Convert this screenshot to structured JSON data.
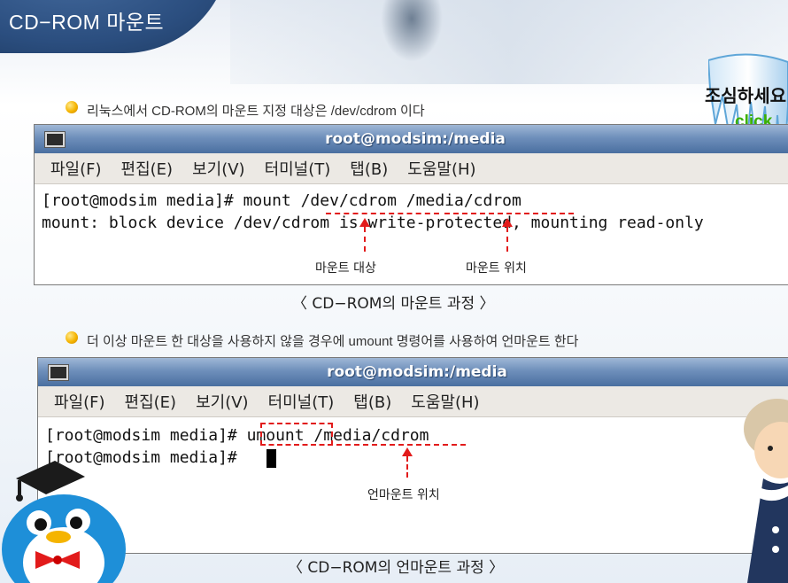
{
  "page": {
    "title": "CD−ROM 마운트"
  },
  "notice": {
    "text": "조심하세요",
    "click": "click"
  },
  "section1": {
    "bullet": "리눅스에서 CD-ROM의 마운트 지정 대상은 /dev/cdrom 이다",
    "window_title": "root@modsim:/media",
    "menu": [
      "파일(F)",
      "편집(E)",
      "보기(V)",
      "터미널(T)",
      "탭(B)",
      "도움말(H)"
    ],
    "lines": [
      "[root@modsim media]# mount /dev/cdrom /media/cdrom",
      "mount: block device /dev/cdrom is write-protected, mounting read-only"
    ],
    "annotation_target": "마운트 대상",
    "annotation_location": "마운트 위치",
    "caption": "〈 CD−ROM의 마운트 과정 〉"
  },
  "section2": {
    "bullet": "더 이상 마운트 한 대상을 사용하지 않을 경우에 umount 명령어를 사용하여 언마운트 한다",
    "window_title": "root@modsim:/media",
    "menu": [
      "파일(F)",
      "편집(E)",
      "보기(V)",
      "터미널(T)",
      "탭(B)",
      "도움말(H)"
    ],
    "lines": [
      "[root@modsim media]# umount /media/cdrom",
      "[root@modsim media]# "
    ],
    "annotation_location": "언마운트 위치",
    "caption": "〈 CD−ROM의 언마운트 과정 〉"
  },
  "colors": {
    "accent_red": "#e21b1b",
    "bullet_yellow": "#f5b400",
    "click_green": "#3bb000"
  }
}
